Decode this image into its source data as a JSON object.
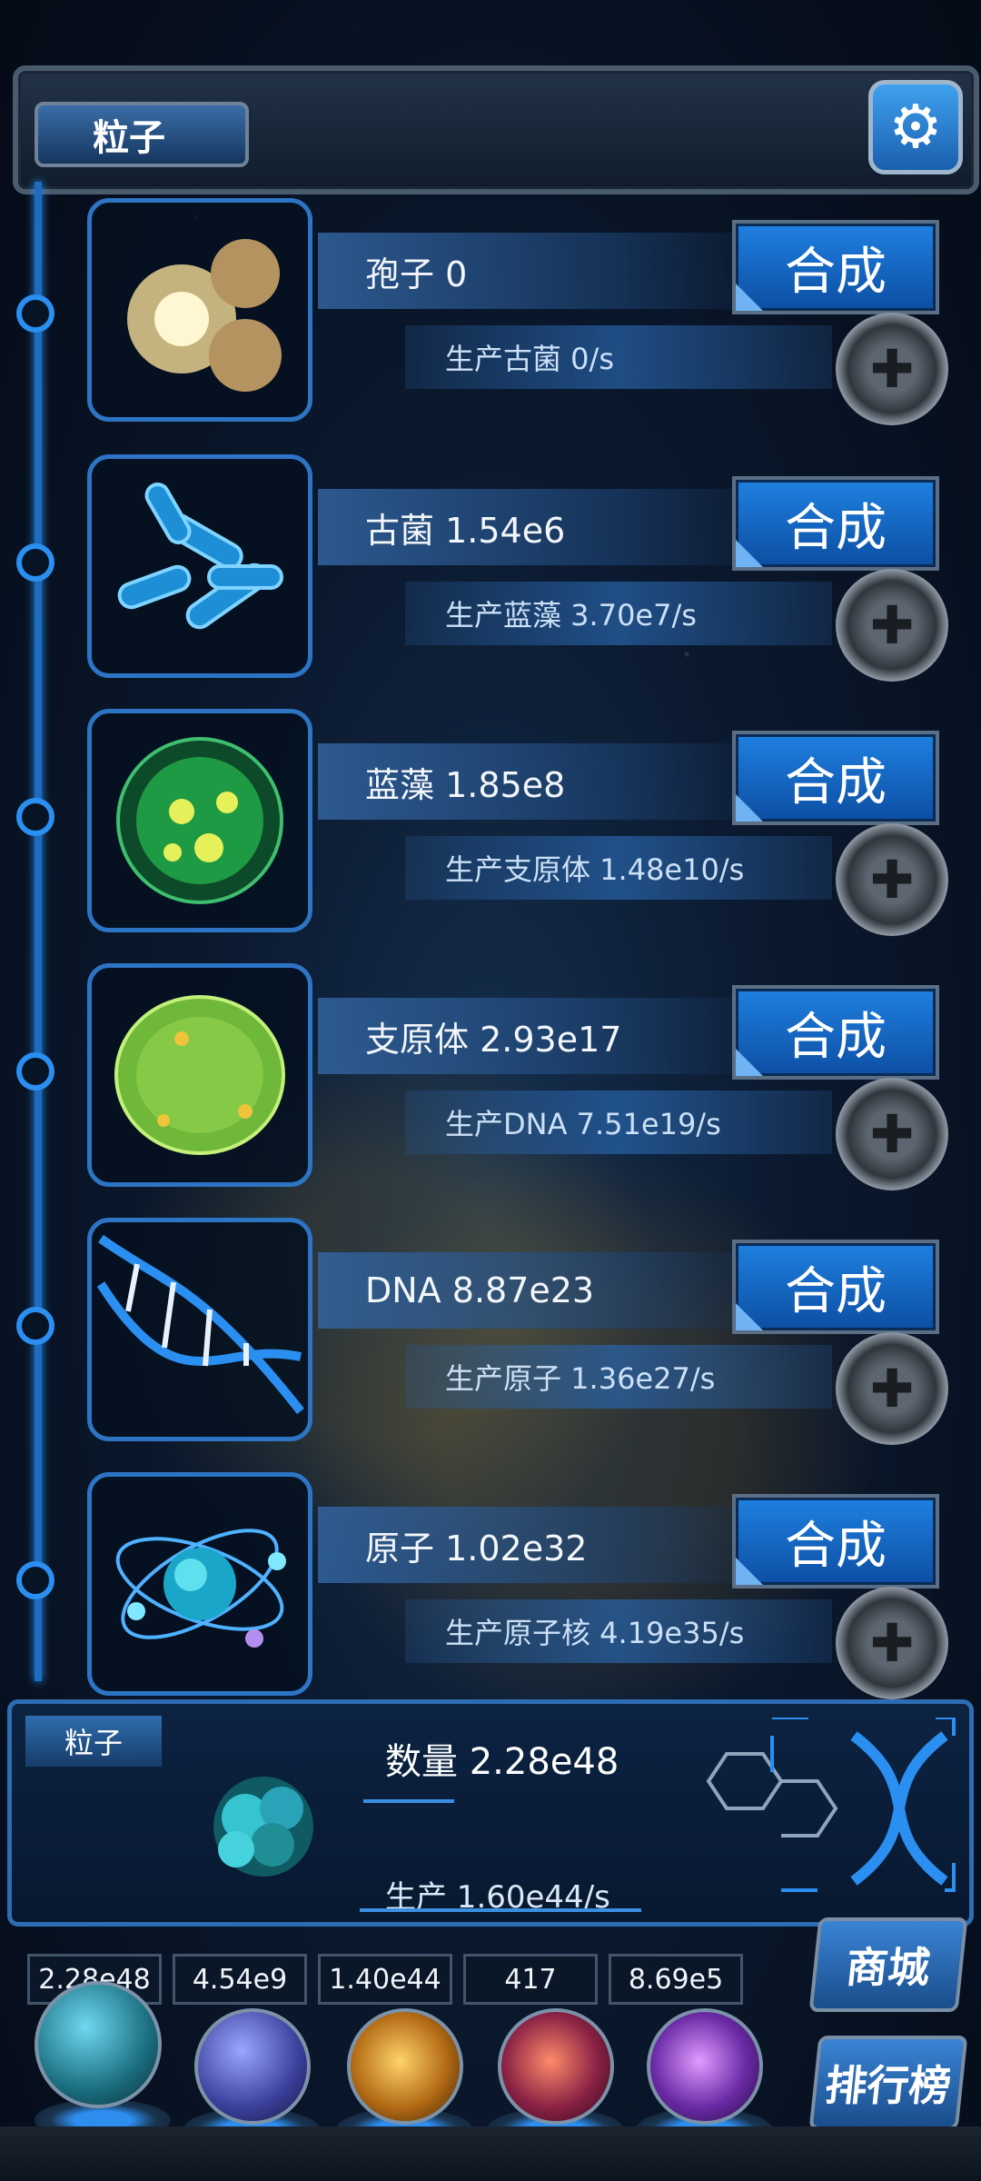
{
  "header": {
    "title": "粒子"
  },
  "rows": [
    {
      "name_label": "孢子 0",
      "prod_label": "生产古菌 0/s",
      "button_label": "合成",
      "icon": "spore-icon"
    },
    {
      "name_label": "古菌 1.54e6",
      "prod_label": "生产蓝藻 3.70e7/s",
      "button_label": "合成",
      "icon": "archaea-icon"
    },
    {
      "name_label": "蓝藻 1.85e8",
      "prod_label": "生产支原体 1.48e10/s",
      "button_label": "合成",
      "icon": "cyanobacteria-icon"
    },
    {
      "name_label": "支原体 2.93e17",
      "prod_label": "生产DNA 7.51e19/s",
      "button_label": "合成",
      "icon": "mycoplasma-icon"
    },
    {
      "name_label": "DNA 8.87e23",
      "prod_label": "生产原子 1.36e27/s",
      "button_label": "合成",
      "icon": "dna-icon"
    },
    {
      "name_label": "原子 1.02e32",
      "prod_label": "生产原子核 4.19e35/s",
      "button_label": "合成",
      "icon": "atom-icon"
    }
  ],
  "particle_panel": {
    "tag": "粒子",
    "count_label": "数量 2.28e48",
    "prod_label": "生产 1.60e44/s"
  },
  "currencies": [
    "2.28e48",
    "4.54e9",
    "1.40e44",
    "417",
    "8.69e5"
  ],
  "side_buttons": {
    "shop": "商城",
    "ranking": "排行榜"
  },
  "colors": {
    "accent": "#1f80e0",
    "rail": "#2a8ff0"
  }
}
